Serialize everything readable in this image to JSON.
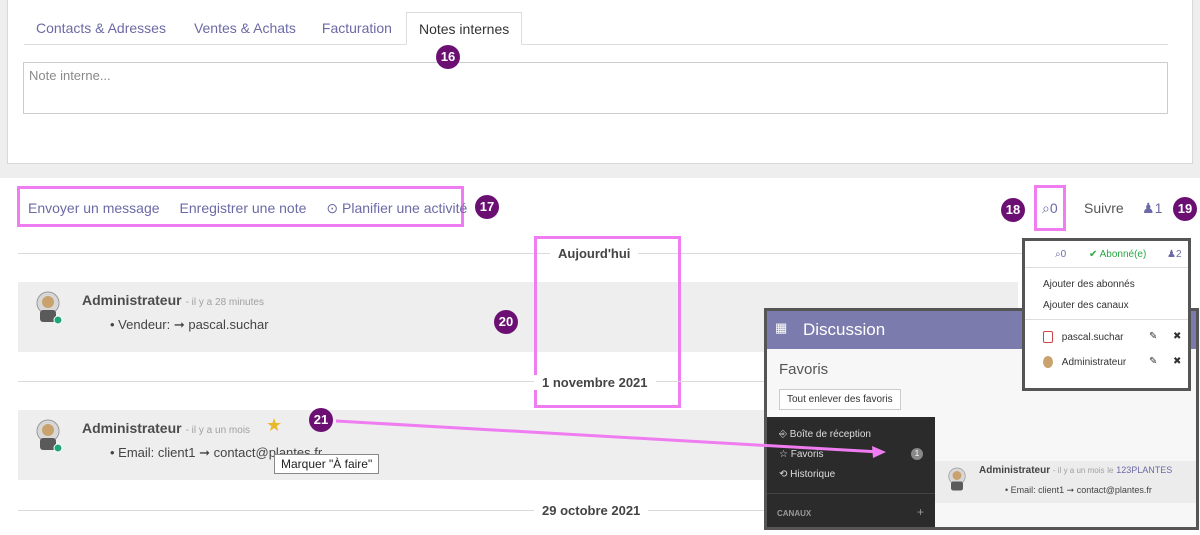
{
  "tabs": [
    "Contacts & Adresses",
    "Ventes & Achats",
    "Facturation",
    "Notes internes"
  ],
  "note_placeholder": "Note interne...",
  "chatter": {
    "send_message": "Envoyer un message",
    "log_note": "Enregistrer une note",
    "schedule_activity": "Planifier une activité",
    "attachments": "0",
    "follow": "Suivre",
    "followers": "1"
  },
  "dates": [
    "Aujourd'hui",
    "1 novembre 2021",
    "29 octobre 2021"
  ],
  "messages": [
    {
      "author": "Administrateur",
      "ago": "- il y a 28 minutes",
      "body": "Vendeur: ➞ pascal.suchar"
    },
    {
      "author": "Administrateur",
      "ago": "- il y a un mois",
      "body": "Email: client1 ➞ contact@plantes.fr"
    }
  ],
  "tooltip": "Marquer \"À faire\"",
  "callouts": [
    "16",
    "17",
    "18",
    "19",
    "20",
    "21"
  ],
  "discussion": {
    "title": "Discussion",
    "favorites_title": "Favoris",
    "unstar_all": "Tout enlever des favoris",
    "sidebar": [
      "Boîte de réception",
      "Favoris",
      "Historique"
    ],
    "favorites_count": "1",
    "channels": "CANAUX",
    "msg_author": "Administrateur",
    "msg_ago": "- il y a un mois",
    "msg_le": "le",
    "msg_record": "123PLANTES",
    "msg_body": "Email: client1 ➞ contact@plantes.fr"
  },
  "followers_panel": {
    "attachments": "0",
    "subscribed": "Abonné(e)",
    "count": "2",
    "add_followers": "Ajouter des abonnés",
    "add_channels": "Ajouter des canaux",
    "followers": [
      "pascal.suchar",
      "Administrateur"
    ]
  },
  "colors": {
    "accent": "#6b6aa6",
    "highlight": "#ef7cf0",
    "callout": "#6b0f73",
    "discussion_header": "#7c7bad"
  }
}
